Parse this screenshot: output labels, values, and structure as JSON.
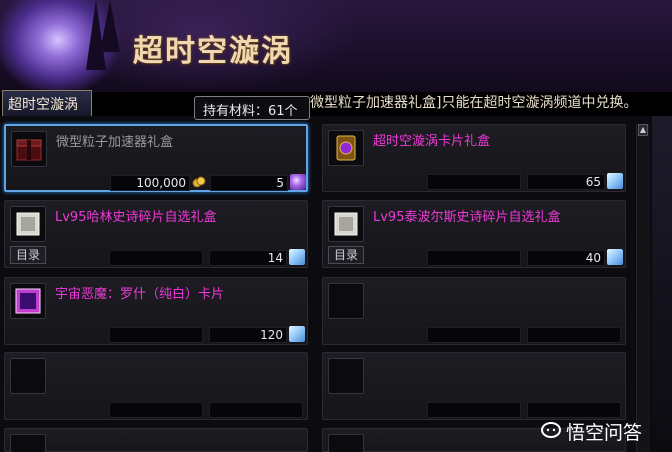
{
  "header": {
    "title": "超时空漩涡",
    "notice": "微型粒子加速器礼盒]只能在超时空漩涡频道中兑换。"
  },
  "tab": {
    "label": "超时空漩涡"
  },
  "tooltip": {
    "text": "持有材料：61个"
  },
  "items": [
    {
      "name": "微型粒子加速器礼盒",
      "color": "gray",
      "cost": "100,000",
      "materials": "5",
      "gem": "purple",
      "catalog": ""
    },
    {
      "name": "超时空漩涡卡片礼盒",
      "color": "pink",
      "cost": "",
      "materials": "65",
      "gem": "feather",
      "catalog": ""
    },
    {
      "name": "Lv95哈林史诗碎片自选礼盒",
      "color": "pink",
      "cost": "",
      "materials": "14",
      "gem": "feather",
      "catalog": "目录"
    },
    {
      "name": "Lv95泰波尔斯史诗碎片自选礼盒",
      "color": "pink",
      "cost": "",
      "materials": "40",
      "gem": "feather",
      "catalog": "目录"
    },
    {
      "name": "宇宙恶魔：罗什（纯白）卡片",
      "color": "pink",
      "cost": "",
      "materials": "120",
      "gem": "feather",
      "catalog": ""
    }
  ],
  "watermark": {
    "text": "悟空问答"
  },
  "colors": {
    "selected_border": "#5fa6e8",
    "item_pink": "#ee3ad8",
    "item_gray": "#9a9a9a",
    "title_gold": "#f0d9b0"
  }
}
